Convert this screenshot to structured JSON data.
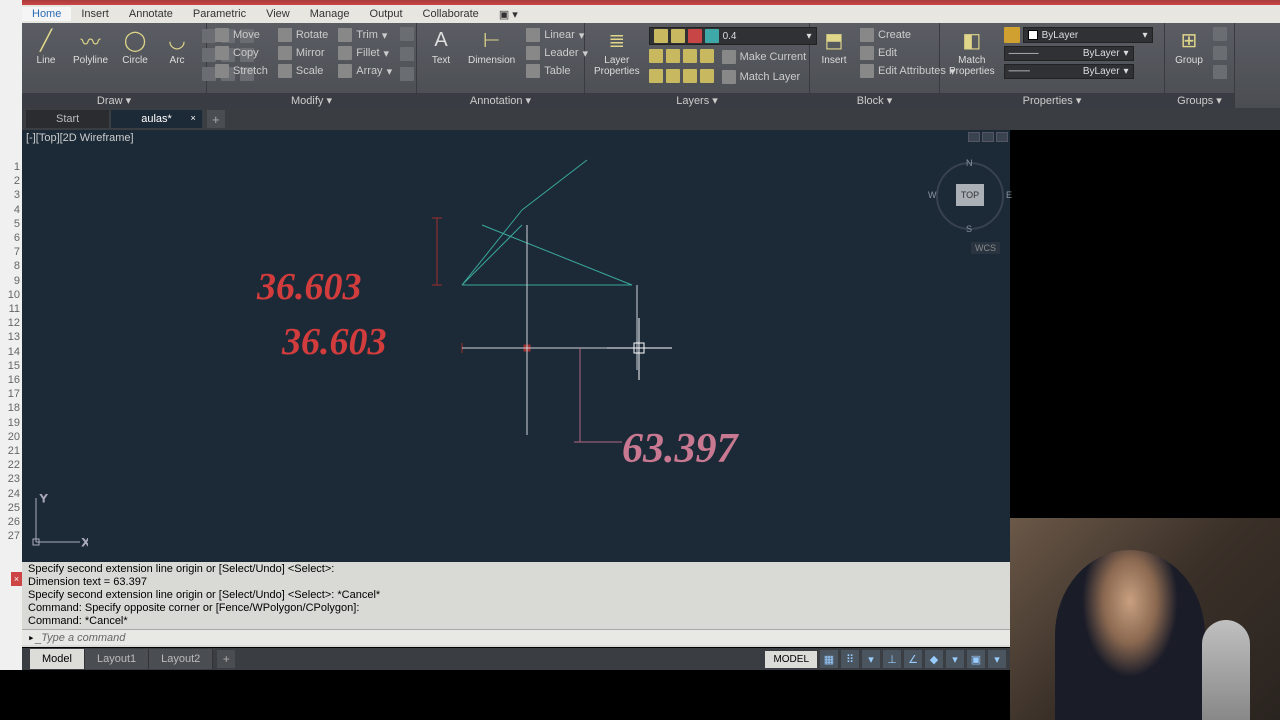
{
  "ribbon": {
    "tabs": [
      "Home",
      "Insert",
      "Annotate",
      "Parametric",
      "View",
      "Manage",
      "Output",
      "Collaborate"
    ],
    "active_tab": "Home",
    "draw": {
      "label": "Draw ▾",
      "line": "Line",
      "polyline": "Polyline",
      "circle": "Circle",
      "arc": "Arc"
    },
    "modify": {
      "label": "Modify ▾",
      "move": "Move",
      "copy": "Copy",
      "stretch": "Stretch",
      "rotate": "Rotate",
      "mirror": "Mirror",
      "scale": "Scale",
      "trim": "Trim",
      "fillet": "Fillet",
      "array": "Array"
    },
    "annotation": {
      "label": "Annotation ▾",
      "text": "Text",
      "dimension": "Dimension",
      "linear": "Linear",
      "leader": "Leader",
      "table": "Table"
    },
    "layers": {
      "label": "Layers ▾",
      "props": "Layer\nProperties",
      "current": "0.4",
      "make": "Make Current",
      "match": "Match Layer"
    },
    "block": {
      "label": "Block ▾",
      "insert": "Insert",
      "create": "Create",
      "edit": "Edit",
      "attrs": "Edit Attributes"
    },
    "properties": {
      "label": "Properties ▾",
      "match": "Match\nProperties",
      "bylayer": "ByLayer"
    },
    "groups": {
      "label": "Groups ▾",
      "group": "Group"
    }
  },
  "file_tabs": {
    "start": "Start",
    "active": "aulas*"
  },
  "viewport": {
    "label": "[-][Top][2D Wireframe]"
  },
  "viewcube": {
    "top": "TOP",
    "n": "N",
    "s": "S",
    "e": "E",
    "w": "W",
    "wcs": "WCS"
  },
  "drawing": {
    "dim1": "36.603",
    "dim2": "36.603",
    "dim3": "63.397",
    "ucs_x": "X",
    "ucs_y": "Y"
  },
  "cmd": {
    "history": "Specify second extension line origin or [Select/Undo] <Select>:\nDimension text = 63.397\nSpecify second extension line origin or [Select/Undo] <Select>: *Cancel*\nCommand: Specify opposite corner or [Fence/WPolygon/CPolygon]:\nCommand: *Cancel*",
    "prompt": "Type a command"
  },
  "layout": {
    "model": "Model",
    "l1": "Layout1",
    "l2": "Layout2"
  },
  "status": {
    "model": "MODEL"
  }
}
